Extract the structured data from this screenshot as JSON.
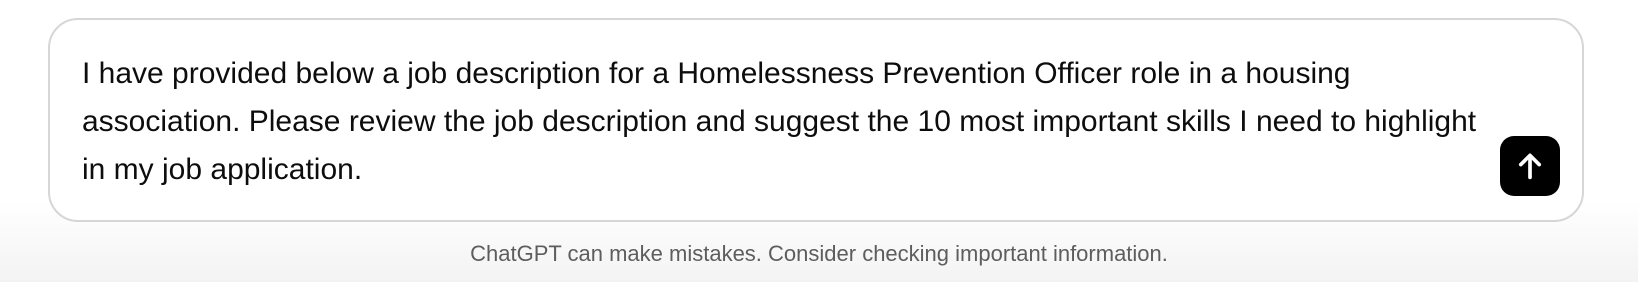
{
  "composer": {
    "message_text": "I have provided below a job description for a Homelessness Prevention Officer role in a housing association. Please review the job description and suggest the 10 most important skills I need to highlight in my job application.",
    "send_button": {
      "icon": "arrow-up-icon",
      "background": "#000000",
      "icon_color": "#ffffff"
    }
  },
  "footer": {
    "disclaimer": "ChatGPT can make mistakes. Consider checking important information."
  }
}
